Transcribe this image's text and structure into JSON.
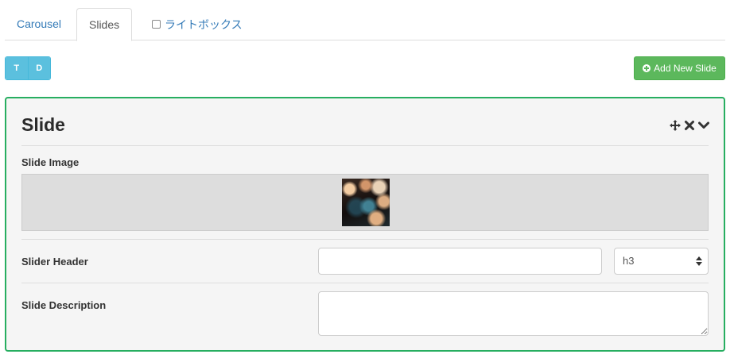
{
  "tabs": [
    {
      "label": "Carousel",
      "active": false
    },
    {
      "label": "Slides",
      "active": true
    },
    {
      "label": "ライトボックス",
      "active": false,
      "has_checkbox": true
    }
  ],
  "toolbar": {
    "t_label": "T",
    "d_label": "D",
    "add_label": "Add New Slide"
  },
  "slide": {
    "title": "Slide",
    "image_label": "Slide Image",
    "header_label": "Slider Header",
    "header_value": "",
    "header_level": "h3",
    "description_label": "Slide Description",
    "description_value": ""
  },
  "colors": {
    "accent_green": "#5cb85c",
    "panel_border": "#27ae60",
    "info_blue": "#5bc0de",
    "link_blue": "#337ab7"
  }
}
